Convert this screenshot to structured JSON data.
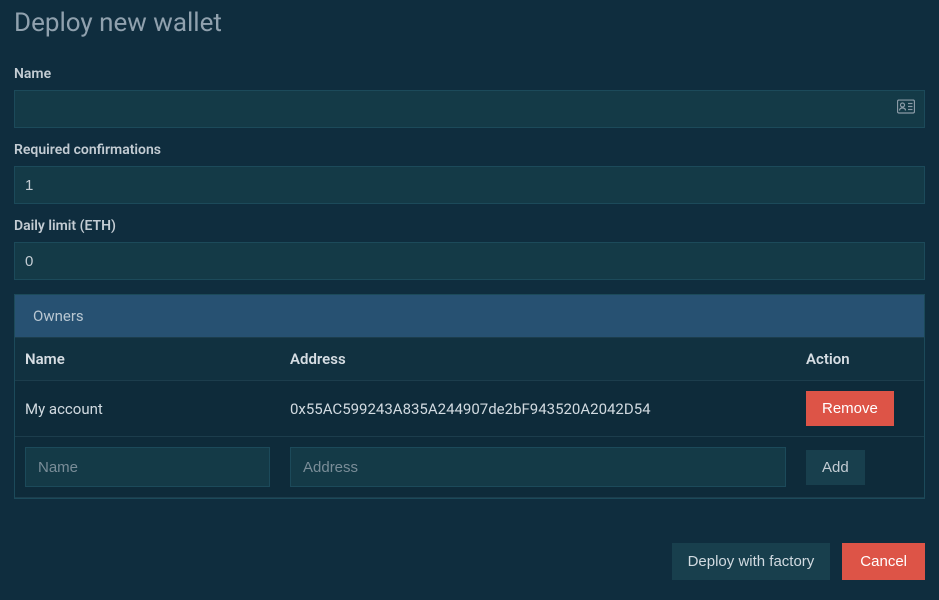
{
  "title": "Deploy new wallet",
  "fields": {
    "name": {
      "label": "Name",
      "value": ""
    },
    "confirmations": {
      "label": "Required confirmations",
      "value": "1"
    },
    "dailyLimit": {
      "label": "Daily limit (ETH)",
      "value": "0"
    }
  },
  "owners": {
    "panelTitle": "Owners",
    "columns": {
      "name": "Name",
      "address": "Address",
      "action": "Action"
    },
    "rows": [
      {
        "name": "My account",
        "address": "0x55AC599243A835A244907de2bF943520A2042D54",
        "removeLabel": "Remove"
      }
    ],
    "newRow": {
      "namePlaceholder": "Name",
      "addressPlaceholder": "Address",
      "addLabel": "Add"
    }
  },
  "footer": {
    "deployLabel": "Deploy with factory",
    "cancelLabel": "Cancel"
  }
}
